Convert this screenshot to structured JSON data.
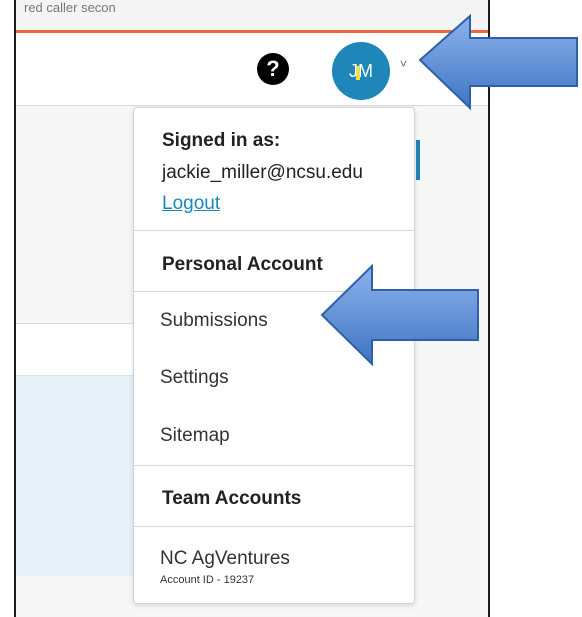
{
  "browser": {
    "url_fragment": "red caller secon"
  },
  "header": {
    "help_icon_glyph": "?",
    "avatar_initials": "JM",
    "avatar_color": "#1e86b8",
    "chevron_glyph": "˅"
  },
  "dropdown": {
    "signed_in_label": "Signed in as:",
    "email": "jackie_miller@ncsu.edu",
    "logout_label": "Logout",
    "personal_header": "Personal Account",
    "personal_items": [
      "Submissions",
      "Settings",
      "Sitemap"
    ],
    "team_header": "Team Accounts",
    "team_name": "NC AgVentures",
    "team_account_id": "Account ID - 19237"
  },
  "colors": {
    "accent_orange": "#e8673c",
    "link_blue": "#1e86b8",
    "arrow_blue": "#5b8fd8"
  }
}
